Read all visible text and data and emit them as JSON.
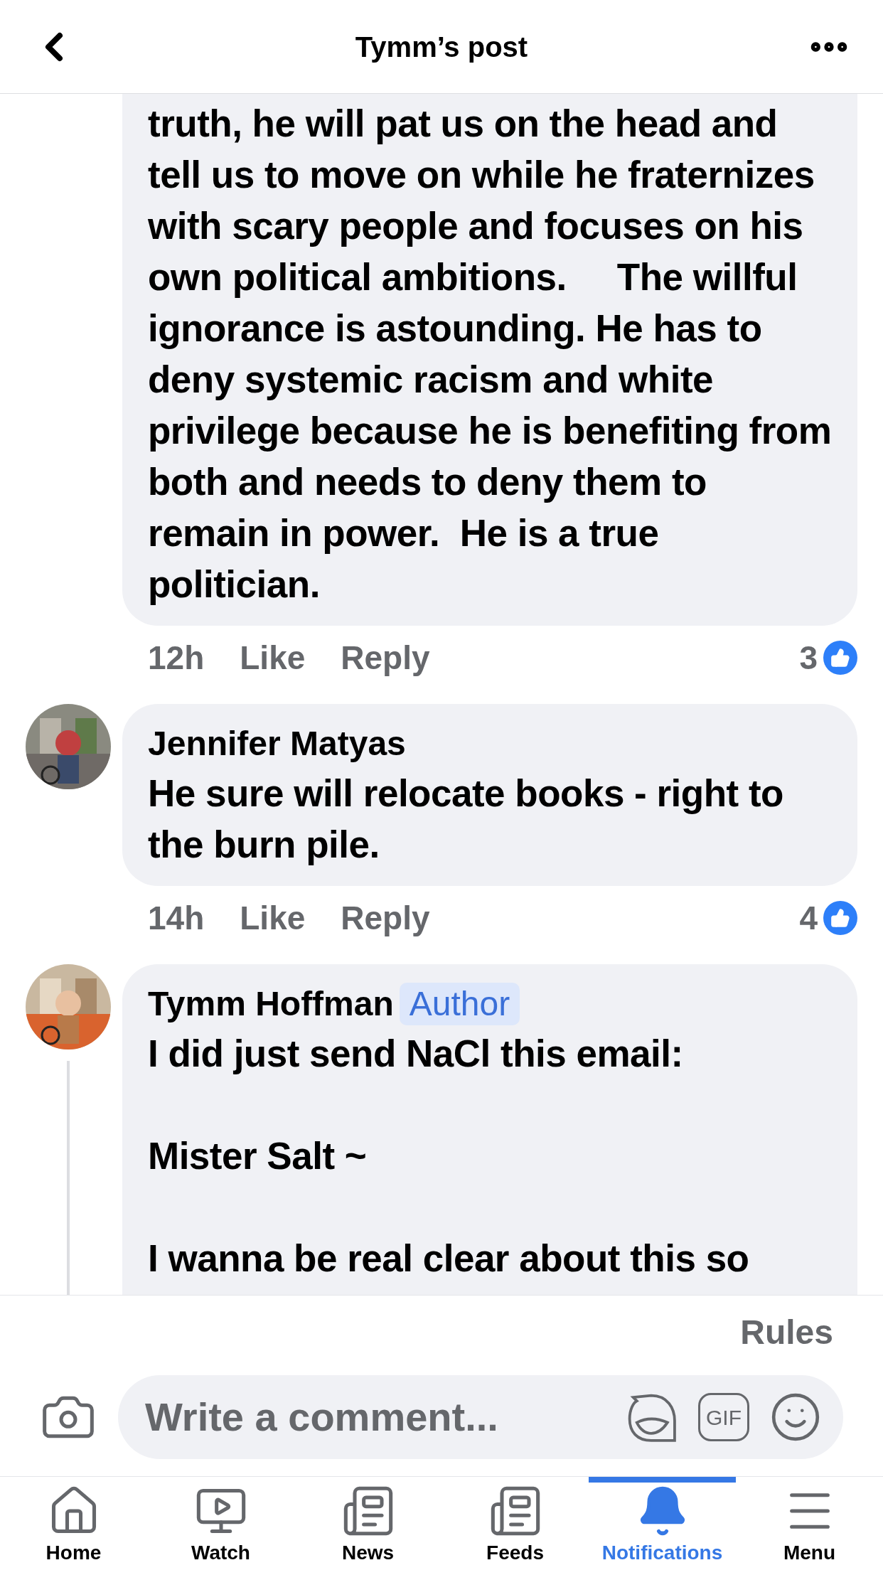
{
  "header": {
    "title": "Tymm’s post"
  },
  "comments": [
    {
      "body": "truth, he will pat us on the head and tell us to move on while he fraternizes with scary people and focuses on his own political ambitions.     The willful ignorance is astounding. He has to deny systemic racism and white privilege because he is benefiting from both and needs to deny them to remain in power.  He is a true politician.",
      "time": "12h",
      "like": "Like",
      "reply": "Reply",
      "like_count": "3",
      "thread_line": false
    },
    {
      "name": "Jennifer Matyas",
      "body": "He sure will relocate books - right to the burn pile.",
      "time": "14h",
      "like": "Like",
      "reply": "Reply",
      "like_count": "4",
      "thread_line": false
    },
    {
      "name": "Tymm Hoffman",
      "author_badge": "Author",
      "body": "I did just send NaCl this email:\n\nMister Salt ~\n\nI wanna be real clear about this so",
      "thread_line": true
    }
  ],
  "composer": {
    "rules": "Rules",
    "placeholder": "Write a comment...",
    "gif_label": "GIF"
  },
  "nav": [
    {
      "label": "Home",
      "selected": false
    },
    {
      "label": "Watch",
      "selected": false
    },
    {
      "label": "News",
      "selected": false
    },
    {
      "label": "Feeds",
      "selected": false
    },
    {
      "label": "Notifications",
      "selected": true
    },
    {
      "label": "Menu",
      "selected": false
    }
  ]
}
